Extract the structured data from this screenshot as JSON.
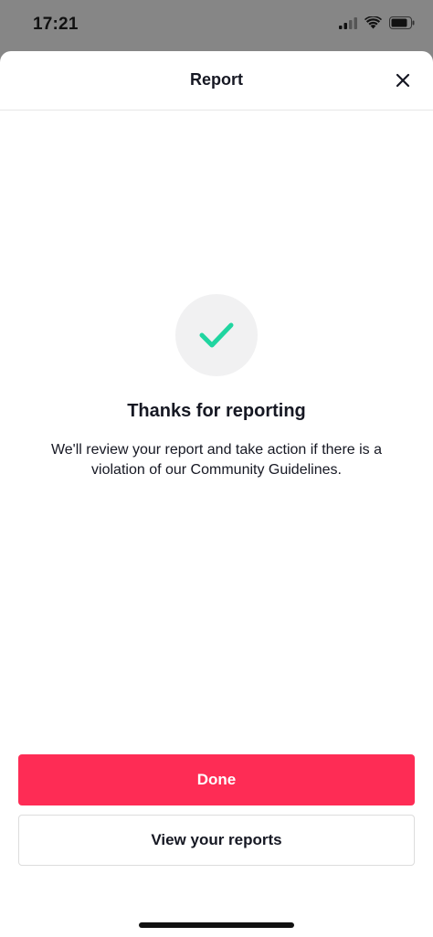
{
  "status_bar": {
    "time": "17:21",
    "icons": [
      "cellular-signal-icon",
      "wifi-icon",
      "battery-icon"
    ]
  },
  "header": {
    "title": "Report",
    "close_icon": "close-icon"
  },
  "confirmation": {
    "icon": "checkmark-icon",
    "headline": "Thanks for reporting",
    "message": "We'll review your report and take action if there is a violation of our Community Guidelines."
  },
  "actions": {
    "done_label": "Done",
    "view_reports_label": "View your reports"
  },
  "colors": {
    "accent": "#fe2c55",
    "check": "#20d5a0",
    "backdrop": "#868686"
  }
}
